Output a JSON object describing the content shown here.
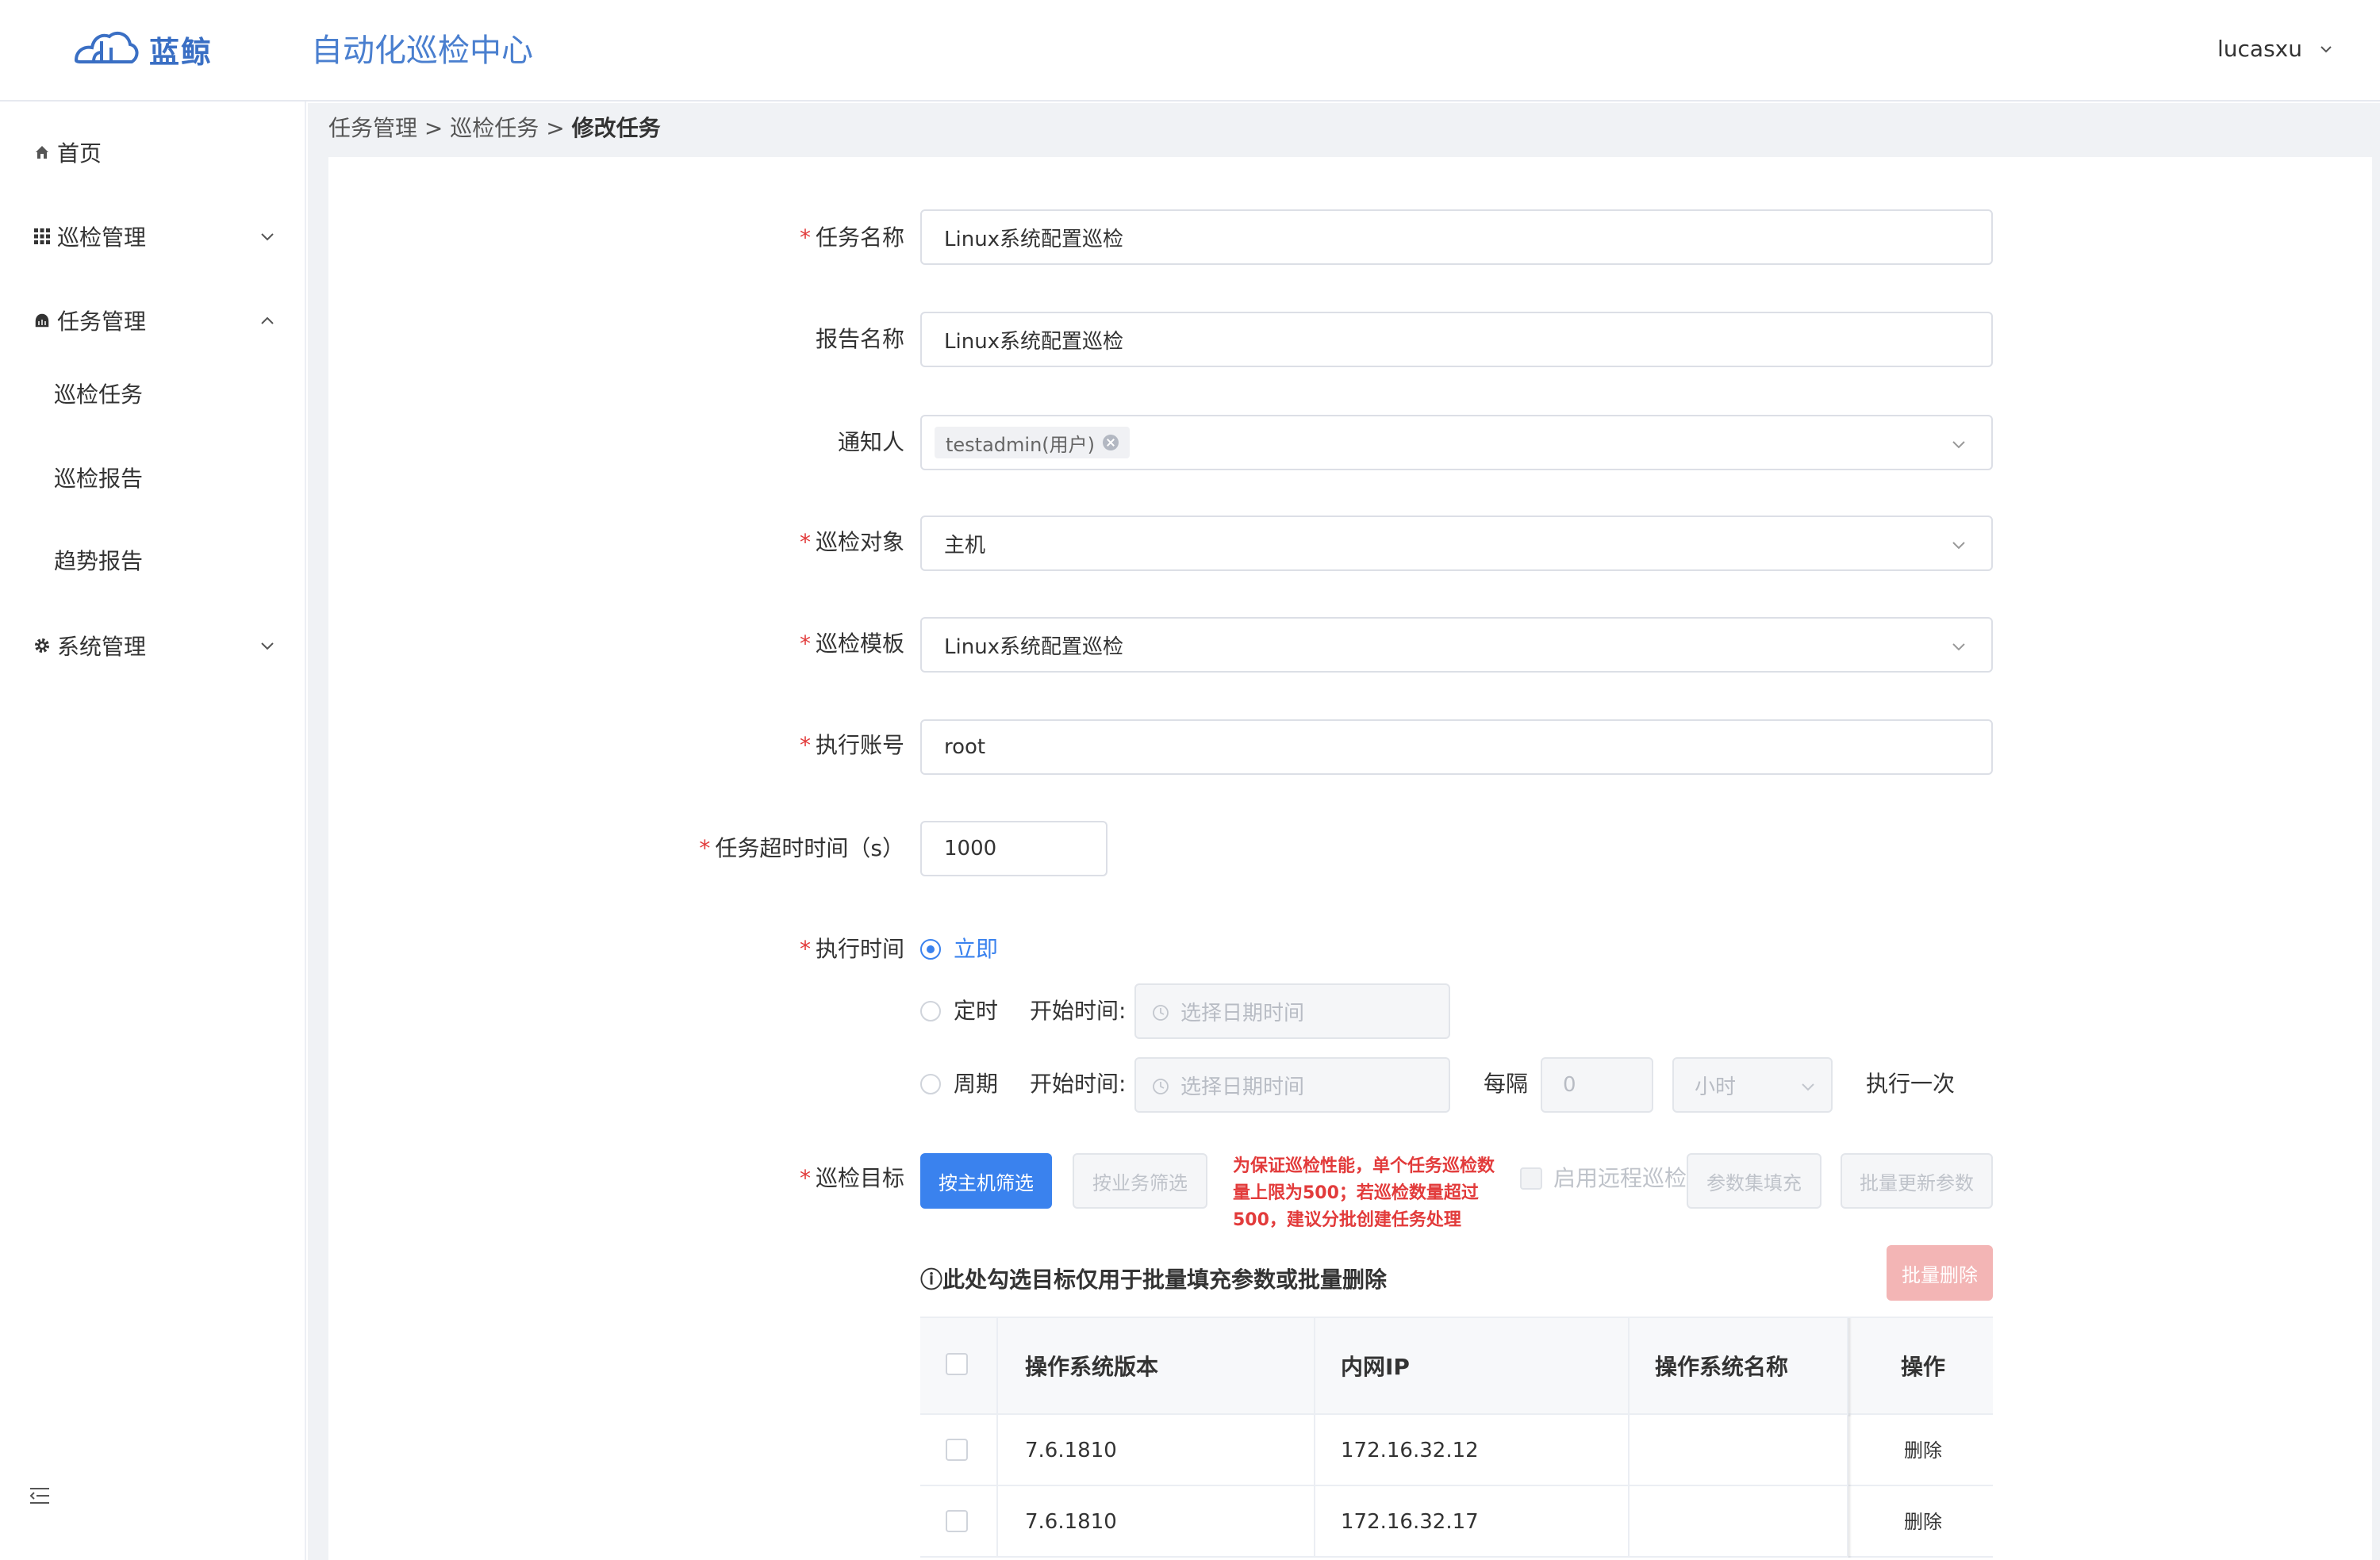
{
  "header": {
    "logo_text": "蓝鲸",
    "app_title": "自动化巡检中心",
    "user_name": "lucasxu"
  },
  "sidebar": {
    "items": [
      {
        "label": "首页",
        "icon": "home-icon"
      },
      {
        "label": "巡检管理",
        "icon": "grid-icon",
        "expanded": false
      },
      {
        "label": "任务管理",
        "icon": "task-icon",
        "expanded": true
      },
      {
        "label": "系统管理",
        "icon": "gear-icon",
        "expanded": false
      }
    ],
    "sub_items": [
      {
        "label": "巡检任务"
      },
      {
        "label": "巡检报告"
      },
      {
        "label": "趋势报告"
      }
    ]
  },
  "breadcrumb": {
    "part1": "任务管理",
    "sep": " > ",
    "part2": "巡检任务",
    "current": "修改任务"
  },
  "form": {
    "task_name": {
      "label": "任务名称",
      "required": true,
      "value": "Linux系统配置巡检"
    },
    "report_name": {
      "label": "报告名称",
      "required": false,
      "value": "Linux系统配置巡检"
    },
    "notify": {
      "label": "通知人",
      "required": false,
      "tag": "testadmin(用户)"
    },
    "target_type": {
      "label": "巡检对象",
      "required": true,
      "value": "主机"
    },
    "template": {
      "label": "巡检模板",
      "required": true,
      "value": "Linux系统配置巡检"
    },
    "account": {
      "label": "执行账号",
      "required": true,
      "value": "root"
    },
    "timeout": {
      "label": "任务超时时间（s）",
      "required": true,
      "value": "1000"
    },
    "exec_time": {
      "label": "执行时间",
      "required": true,
      "options": [
        {
          "label": "立即",
          "selected": true
        },
        {
          "label": "定时",
          "selected": false
        },
        {
          "label": "周期",
          "selected": false
        }
      ],
      "start_label": "开始时间:",
      "date_placeholder": "选择日期时间",
      "every_label": "每隔",
      "interval_value": "0",
      "unit_value": "小时",
      "once_label": "执行一次"
    },
    "targets": {
      "label": "巡检目标",
      "required": true,
      "btn_by_host": "按主机筛选",
      "btn_by_business": "按业务筛选",
      "warning": "为保证巡检性能，单个任务巡检数量上限为500；若巡检数量超过500，建议分批创建任务处理",
      "remote_label": "启用远程巡检",
      "btn_param_fill": "参数集填充",
      "btn_batch_update": "批量更新参数",
      "btn_batch_delete": "批量删除",
      "note": "ⓘ此处勾选目标仅用于批量填充参数或批量删除"
    }
  },
  "table": {
    "columns": [
      "操作系统版本",
      "内网IP",
      "操作系统名称",
      "操作"
    ],
    "rows": [
      {
        "os_version": "7.6.1810",
        "ip": "172.16.32.12",
        "os_name": "",
        "action": "删除"
      },
      {
        "os_version": "7.6.1810",
        "ip": "172.16.32.17",
        "os_name": "",
        "action": "删除"
      }
    ]
  },
  "colors": {
    "primary": "#3a82ee",
    "required": "#e23b3b",
    "danger_disabled": "#f3b5b5"
  }
}
